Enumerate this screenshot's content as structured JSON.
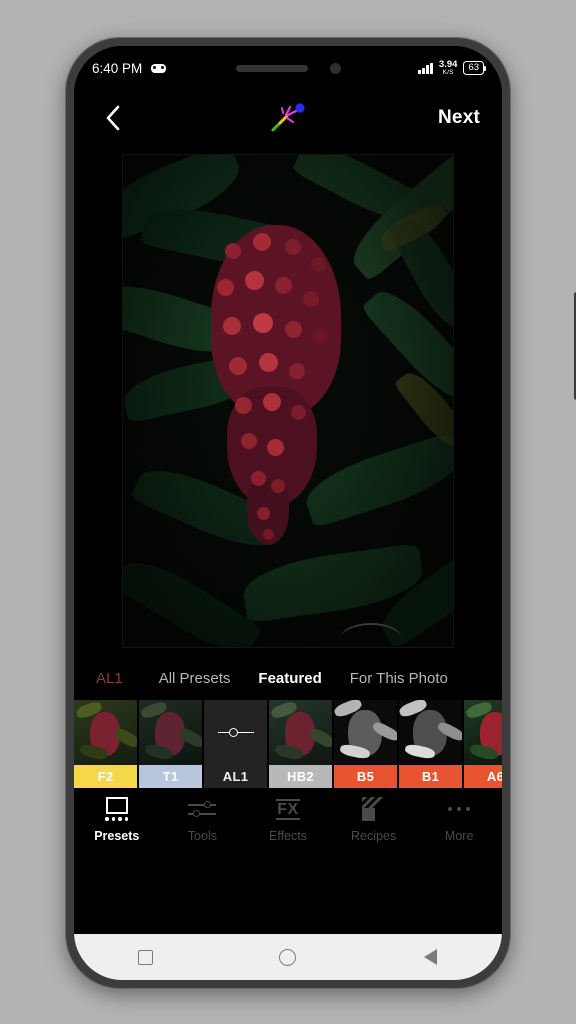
{
  "status_bar": {
    "time": "6:40 PM",
    "game_mode_icon": "game-controller-icon",
    "network_speed_value": "3.94",
    "network_speed_unit": "K/S",
    "battery_level": "63",
    "signal_icon": "signal-bars-icon"
  },
  "header": {
    "back_icon": "chevron-left-icon",
    "center_icon": "magic-wand-icon",
    "next_label": "Next"
  },
  "photo": {
    "subject": "red sumac berry cluster on dark green foliage",
    "drag_handle_icon": "drag-handle-icon"
  },
  "preset_tabs": [
    {
      "label": "AL1",
      "state": "tag"
    },
    {
      "label": "All Presets",
      "state": "inactive"
    },
    {
      "label": "Featured",
      "state": "active"
    },
    {
      "label": "For This Photo",
      "state": "inactive"
    }
  ],
  "presets": [
    {
      "label": "F2",
      "label_bg": "#f5d849",
      "label_fg": "#ffffff",
      "style": "photo",
      "tone": "warm"
    },
    {
      "label": "T1",
      "label_bg": "#b8c6dd",
      "label_fg": "#ffffff",
      "style": "photo",
      "tone": "cool"
    },
    {
      "label": "AL1",
      "label_bg": "#232323",
      "label_fg": "#f0f0f0",
      "style": "adjust",
      "icon": "slider-icon"
    },
    {
      "label": "HB2",
      "label_bg": "#b8b8b8",
      "label_fg": "#ffffff",
      "style": "photo",
      "tone": "neutral"
    },
    {
      "label": "B5",
      "label_bg": "#e8542f",
      "label_fg": "#ffffff",
      "style": "photo",
      "tone": "bw"
    },
    {
      "label": "B1",
      "label_bg": "#e8542f",
      "label_fg": "#ffffff",
      "style": "photo",
      "tone": "bw"
    },
    {
      "label": "A6",
      "label_bg": "#e8542f",
      "label_fg": "#ffffff",
      "style": "photo",
      "tone": "vivid"
    }
  ],
  "toolbar": [
    {
      "label": "Presets",
      "icon": "presets-icon",
      "state": "active"
    },
    {
      "label": "Tools",
      "icon": "sliders-icon",
      "state": "inactive"
    },
    {
      "label": "Effects",
      "icon": "fx-icon",
      "icon_text": "FX",
      "state": "inactive"
    },
    {
      "label": "Recipes",
      "icon": "recipes-icon",
      "state": "inactive"
    },
    {
      "label": "More",
      "icon": "more-dots-icon",
      "state": "inactive"
    }
  ],
  "android_nav": {
    "recents_icon": "square-icon",
    "home_icon": "circle-icon",
    "back_icon": "triangle-back-icon"
  },
  "colors": {
    "accent_red": "#e8542f",
    "tag_red": "#8c3b3b",
    "screen_bg": "#000000",
    "frame": "#3c3c3c",
    "page_bg": "#b3b3b3"
  }
}
